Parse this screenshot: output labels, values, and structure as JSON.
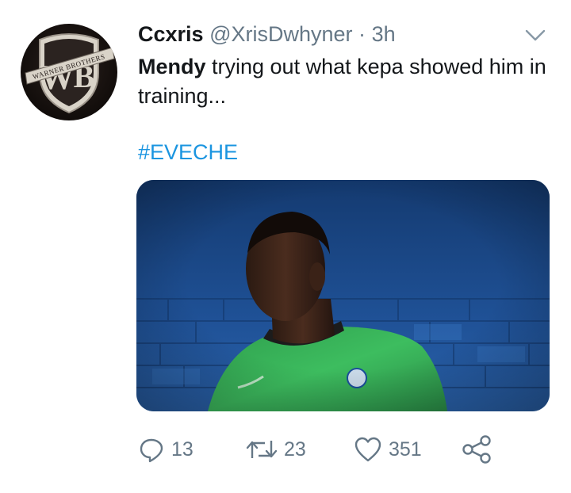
{
  "tweet": {
    "author_name": "Ccxris",
    "handle": "@XrisDwhyner",
    "separator": "·",
    "time": "3h",
    "text_bold": "Mendy",
    "text_rest": " trying out what kepa showed him in training...",
    "hashtag": "#EVECHE",
    "avatar_logo_text": "WARNER BROTHERS"
  },
  "actions": {
    "reply_count": "13",
    "retweet_count": "23",
    "like_count": "351"
  },
  "icons": {
    "reply": "reply-icon",
    "retweet": "retweet-icon",
    "like": "heart-icon",
    "share": "share-icon",
    "menu": "chevron-down-icon"
  },
  "colors": {
    "hashtag": "#1b95e0",
    "muted": "#657786",
    "text": "#14171a",
    "jersey": "#3bbd5c",
    "wall": "#1d4c8c"
  }
}
